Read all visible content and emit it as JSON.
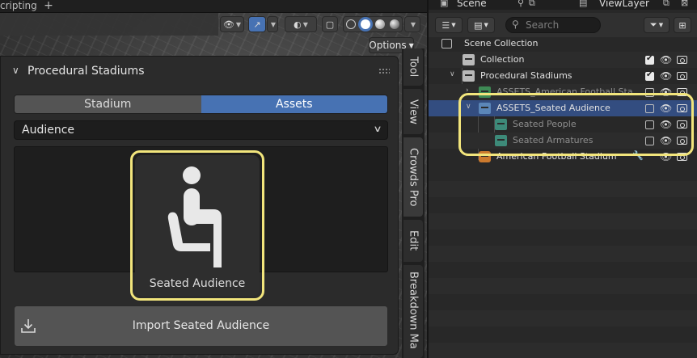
{
  "window": {
    "workspace_tab": "cripting",
    "add_tab": "+"
  },
  "viewport": {
    "options_label": "Options",
    "shading_modes": [
      "wireframe",
      "solid",
      "material-preview",
      "rendered"
    ],
    "active_shading": "solid"
  },
  "panel": {
    "title": "Procedural Stadiums",
    "tabs": [
      {
        "label": "Stadium",
        "active": false
      },
      {
        "label": "Assets",
        "active": true
      }
    ],
    "category_dropdown": {
      "value": "Audience"
    },
    "asset": {
      "label": "Seated Audience",
      "icon": "seated-person-icon"
    },
    "import_button": {
      "label": "Import Seated Audience",
      "icon": "import-download-icon"
    }
  },
  "sidebar_tabs": [
    "Tool",
    "View",
    "Crowds Pro",
    "Edit",
    "Breakdown Ma"
  ],
  "outliner": {
    "scene": "Scene",
    "view_layer": "ViewLayer",
    "search_placeholder": "Search",
    "rows": [
      {
        "label": "Scene Collection",
        "depth": 0
      },
      {
        "label": "Collection",
        "depth": 1,
        "checked": true
      },
      {
        "label": "Procedural Stadiums",
        "depth": 1,
        "expanded": true,
        "checked": true
      },
      {
        "label": "ASSETS_American Football Stadiu",
        "depth": 2,
        "checked": false
      },
      {
        "label": "ASSETS_Seated Audience",
        "depth": 2,
        "expanded": true,
        "selected": true,
        "checked": false
      },
      {
        "label": "Seated People",
        "depth": 3,
        "checked": false
      },
      {
        "label": "Seated Armatures",
        "depth": 3,
        "checked": false
      },
      {
        "label": "American Football Stadium",
        "depth": 2
      }
    ]
  },
  "colors": {
    "accent": "#4772b3",
    "highlight": "#f2e57c",
    "selection": "#334d80"
  }
}
